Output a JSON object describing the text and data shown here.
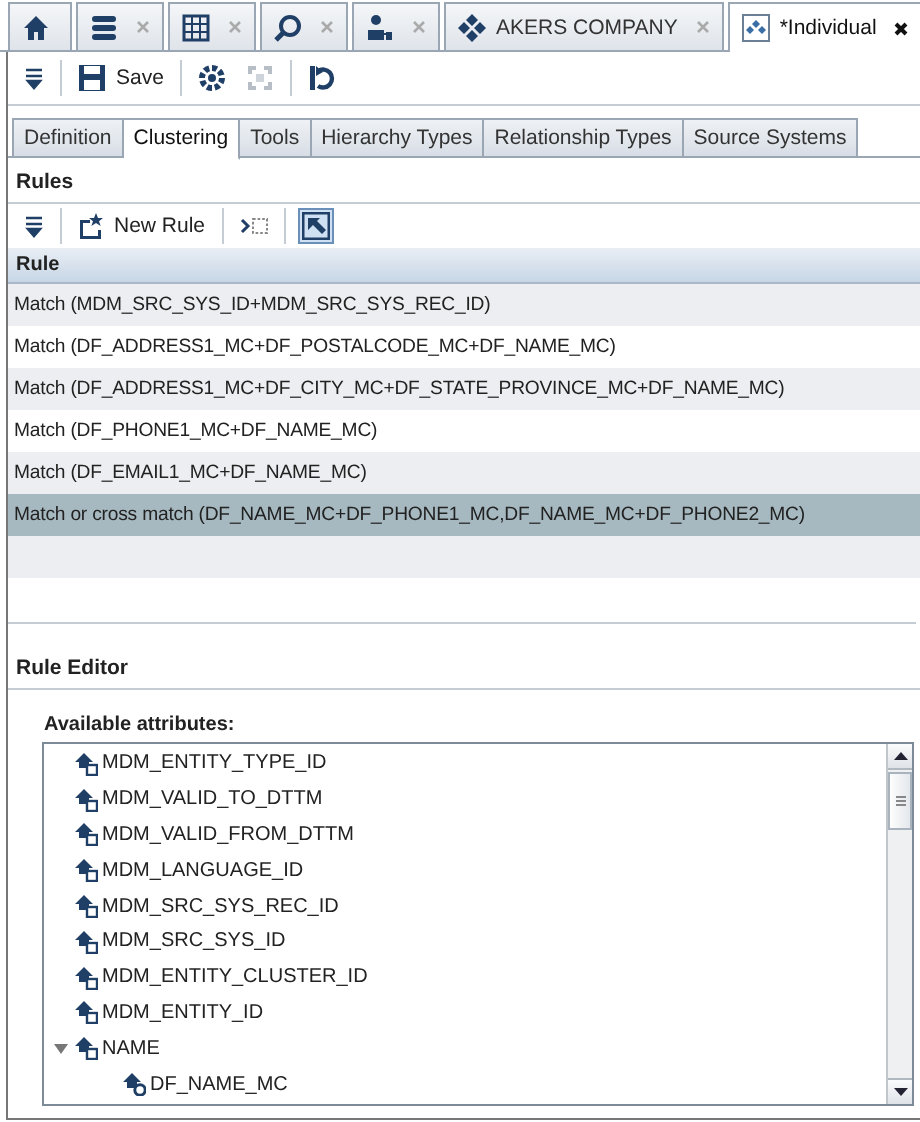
{
  "document_tabs": [
    {
      "kind": "home",
      "selected": false,
      "closable": false
    },
    {
      "kind": "database",
      "selected": false,
      "closable": true
    },
    {
      "kind": "grid",
      "selected": false,
      "closable": true
    },
    {
      "kind": "search",
      "selected": false,
      "closable": true
    },
    {
      "kind": "hierarchy",
      "selected": false,
      "closable": true
    },
    {
      "kind": "entity",
      "label": "AKERS COMPANY",
      "selected": false,
      "closable": true
    },
    {
      "kind": "entity-type",
      "label": "*Individual",
      "selected": true,
      "closable": true
    }
  ],
  "toolbar": {
    "save_label": "Save"
  },
  "section_tabs": [
    {
      "label": "Definition",
      "selected": false
    },
    {
      "label": "Clustering",
      "selected": true
    },
    {
      "label": "Tools",
      "selected": false
    },
    {
      "label": "Hierarchy Types",
      "selected": false
    },
    {
      "label": "Relationship Types",
      "selected": false
    },
    {
      "label": "Source Systems",
      "selected": false
    }
  ],
  "rules": {
    "title": "Rules",
    "new_rule_label": "New Rule",
    "select_mode_on": true,
    "column": "Rule",
    "rows": [
      {
        "text": "Match (MDM_SRC_SYS_ID+MDM_SRC_SYS_REC_ID)",
        "selected": false
      },
      {
        "text": "Match (DF_ADDRESS1_MC+DF_POSTALCODE_MC+DF_NAME_MC)",
        "selected": false
      },
      {
        "text": "Match (DF_ADDRESS1_MC+DF_CITY_MC+DF_STATE_PROVINCE_MC+DF_NAME_MC)",
        "selected": false
      },
      {
        "text": "Match (DF_PHONE1_MC+DF_NAME_MC)",
        "selected": false
      },
      {
        "text": "Match (DF_EMAIL1_MC+DF_NAME_MC)",
        "selected": false
      },
      {
        "text": "Match or cross match (DF_NAME_MC+DF_PHONE1_MC,DF_NAME_MC+DF_PHONE2_MC)",
        "selected": true
      }
    ]
  },
  "rule_editor": {
    "title": "Rule Editor",
    "attributes_label": "Available attributes:",
    "attributes": [
      {
        "kind": "attribute",
        "label": "MDM_ENTITY_TYPE_ID"
      },
      {
        "kind": "attribute",
        "label": "MDM_VALID_TO_DTTM"
      },
      {
        "kind": "attribute",
        "label": "MDM_VALID_FROM_DTTM"
      },
      {
        "kind": "attribute",
        "label": "MDM_LANGUAGE_ID"
      },
      {
        "kind": "attribute",
        "label": "MDM_SRC_SYS_REC_ID"
      },
      {
        "kind": "attribute",
        "label": "MDM_SRC_SYS_ID"
      },
      {
        "kind": "attribute",
        "label": "MDM_ENTITY_CLUSTER_ID"
      },
      {
        "kind": "attribute",
        "label": "MDM_ENTITY_ID"
      },
      {
        "kind": "attribute",
        "label": "NAME",
        "expanded": true,
        "children": [
          {
            "kind": "match-code",
            "label": "DF_NAME_MC"
          }
        ]
      }
    ]
  }
}
